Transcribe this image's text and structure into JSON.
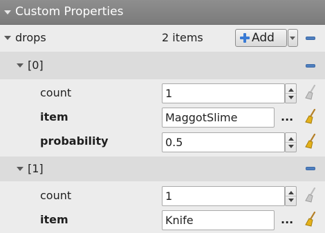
{
  "panel": {
    "title": "Custom Properties"
  },
  "drops": {
    "label": "drops",
    "count_text": "2 items",
    "add_label": "Add"
  },
  "items": [
    {
      "index_label": "[0]",
      "count_label": "count",
      "count_value": "1",
      "item_label": "item",
      "item_value": "MaggotSlime",
      "item_more": "...",
      "probability_label": "probability",
      "probability_value": "0.5"
    },
    {
      "index_label": "[1]",
      "count_label": "count",
      "count_value": "1",
      "item_label": "item",
      "item_value": "Knife",
      "item_more": "..."
    }
  ],
  "icons": {
    "collapse": "triangle-down-icon",
    "remove": "minus-icon",
    "add": "plus-icon",
    "reset": "broom-icon"
  },
  "colors": {
    "header_bg": "#848484",
    "accent_blue": "#4f7fbe",
    "broom_active": "#e4b21b",
    "broom_inactive": "#bdbdbd"
  }
}
